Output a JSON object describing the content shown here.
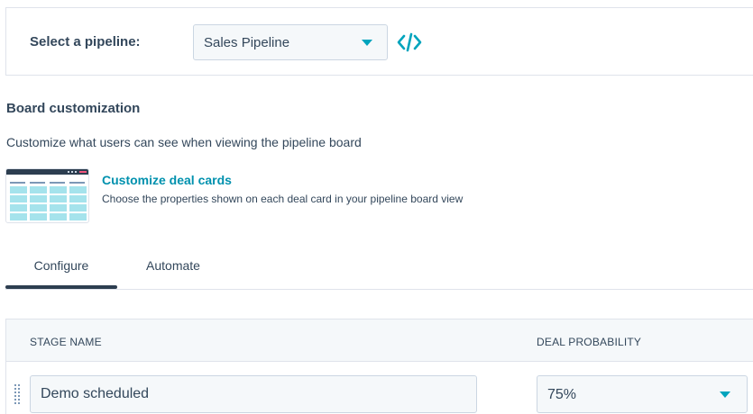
{
  "pipeline": {
    "label": "Select a pipeline:",
    "selected": "Sales Pipeline",
    "embed_icon": "code-embed-icon"
  },
  "board": {
    "title": "Board customization",
    "description": "Customize what users can see when viewing the pipeline board",
    "card_link": "Customize deal cards",
    "card_description": "Choose the properties shown on each deal card in your pipeline board view"
  },
  "tabs": [
    {
      "label": "Configure",
      "active": true
    },
    {
      "label": "Automate",
      "active": false
    }
  ],
  "table": {
    "headers": [
      "STAGE NAME",
      "DEAL PROBABILITY"
    ],
    "rows": [
      {
        "stage_name": "Demo scheduled",
        "deal_probability": "75%"
      }
    ]
  },
  "colors": {
    "accent": "#00a4bd",
    "link": "#0091ae",
    "text": "#33475b",
    "tab_indicator": "#2d3e50"
  }
}
